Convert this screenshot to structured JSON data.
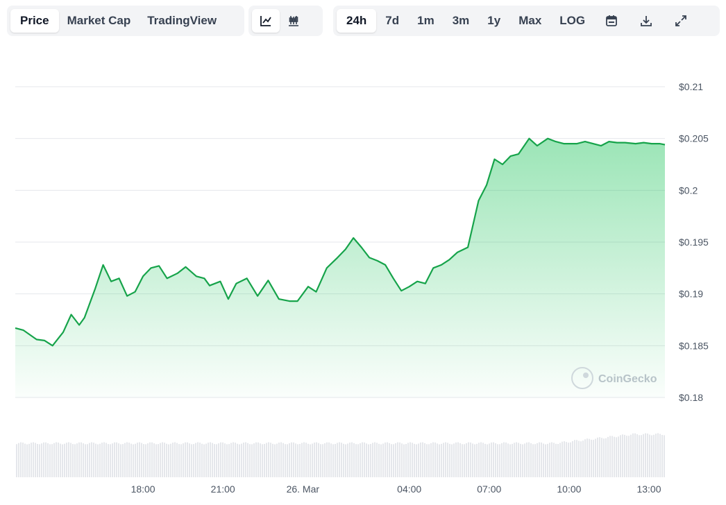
{
  "toolbar": {
    "metric_tabs": [
      {
        "label": "Price",
        "active": true
      },
      {
        "label": "Market Cap",
        "active": false
      },
      {
        "label": "TradingView",
        "active": false
      }
    ],
    "chart_type_icons": [
      "line-chart-icon",
      "candlestick-chart-icon"
    ],
    "range_tabs": [
      {
        "label": "24h",
        "active": true
      },
      {
        "label": "7d",
        "active": false
      },
      {
        "label": "1m",
        "active": false
      },
      {
        "label": "3m",
        "active": false
      },
      {
        "label": "1y",
        "active": false
      },
      {
        "label": "Max",
        "active": false
      },
      {
        "label": "LOG",
        "active": false
      }
    ],
    "action_icons": [
      "calendar-icon",
      "download-icon",
      "expand-icon"
    ]
  },
  "watermark": "CoinGecko",
  "colors": {
    "line": "#16a34a",
    "fill": "#22c55e",
    "volume": "#e5e7eb",
    "grid": "#e5e7eb"
  },
  "chart_data": {
    "type": "area",
    "title": "",
    "xlabel": "",
    "ylabel": "",
    "x_ticks": [
      "18:00",
      "21:00",
      "26. Mar",
      "04:00",
      "07:00",
      "10:00",
      "13:00"
    ],
    "x_tick_hours": [
      18,
      21,
      24,
      28,
      31,
      34,
      37
    ],
    "x_range_hours": [
      13.2,
      37.6
    ],
    "y_ticks": [
      "$0.18",
      "$0.185",
      "$0.19",
      "$0.195",
      "$0.2",
      "$0.205",
      "$0.21"
    ],
    "ylim": [
      0.18,
      0.21
    ],
    "grid": true,
    "series": [
      {
        "x": [
          13.2,
          13.5,
          14.0,
          14.3,
          14.6,
          15.0,
          15.3,
          15.6,
          15.8,
          16.2,
          16.5,
          16.8,
          17.1,
          17.4,
          17.7,
          18.0,
          18.3,
          18.6,
          18.9,
          19.3,
          19.6,
          20.0,
          20.3,
          20.5,
          20.9,
          21.2,
          21.5,
          21.9,
          22.3,
          22.7,
          23.1,
          23.5,
          23.8,
          24.2,
          24.5,
          24.9,
          25.3,
          25.6,
          25.9,
          26.2,
          26.5,
          26.8,
          27.1,
          27.4,
          27.7,
          28.0,
          28.3,
          28.6,
          28.9,
          29.2,
          29.5,
          29.8,
          30.2,
          30.6,
          30.9,
          31.2,
          31.5,
          31.8,
          32.1,
          32.5,
          32.8,
          33.2,
          33.5,
          33.8,
          34.0,
          34.3,
          34.6,
          34.9,
          35.2,
          35.5,
          35.8,
          36.1,
          36.5,
          36.8,
          37.1,
          37.4,
          37.6
        ],
        "y": [
          0.1867,
          0.1865,
          0.1856,
          0.1855,
          0.185,
          0.1863,
          0.188,
          0.187,
          0.1877,
          0.1905,
          0.1928,
          0.1912,
          0.1915,
          0.1898,
          0.1902,
          0.1917,
          0.1925,
          0.1927,
          0.1915,
          0.192,
          0.1926,
          0.1917,
          0.1915,
          0.1908,
          0.1912,
          0.1895,
          0.191,
          0.1915,
          0.1898,
          0.1913,
          0.1895,
          0.1893,
          0.1893,
          0.1907,
          0.1902,
          0.1925,
          0.1935,
          0.1943,
          0.1954,
          0.1945,
          0.1935,
          0.1932,
          0.1928,
          0.1915,
          0.1903,
          0.1907,
          0.1912,
          0.191,
          0.1925,
          0.1928,
          0.1933,
          0.194,
          0.1945,
          0.199,
          0.2005,
          0.203,
          0.2025,
          0.2033,
          0.2035,
          0.205,
          0.2043,
          0.205,
          0.2047,
          0.2045,
          0.2045,
          0.2045,
          0.2047,
          0.2045,
          0.2043,
          0.2047,
          0.2046,
          0.2046,
          0.2045,
          0.2046,
          0.2045,
          0.2045,
          0.2044
        ]
      }
    ]
  }
}
